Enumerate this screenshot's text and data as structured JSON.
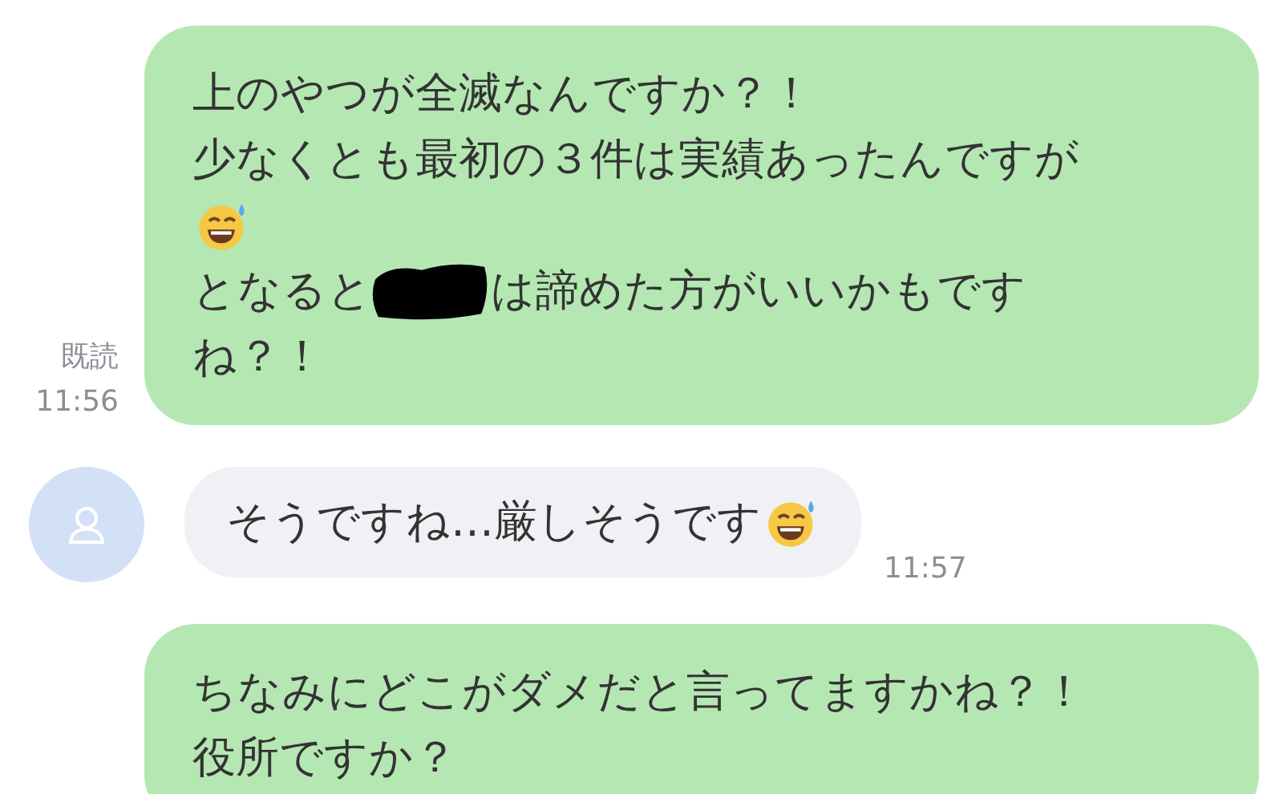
{
  "messages": [
    {
      "kind": "sent",
      "read_receipt": "既読",
      "time": "11:56",
      "lines": [
        [
          {
            "kind": "text",
            "text": "上のやつが全滅なんですか？！"
          }
        ],
        [
          {
            "kind": "text",
            "text": "少なくとも最初の３件は実績あったんですが"
          }
        ],
        [
          {
            "kind": "emoji"
          }
        ],
        [
          {
            "kind": "text",
            "text": "となると"
          },
          {
            "kind": "redaction"
          },
          {
            "kind": "text",
            "text": "は諦めた方がいいかもです"
          }
        ],
        [
          {
            "kind": "text",
            "text": "ね？！"
          }
        ]
      ]
    },
    {
      "kind": "received",
      "time": "11:57",
      "lines": [
        [
          {
            "kind": "text",
            "text": "そうですね…厳しそうです"
          },
          {
            "kind": "emoji"
          }
        ]
      ]
    },
    {
      "kind": "sent",
      "lines": [
        [
          {
            "kind": "text",
            "text": "ちなみにどこがダメだと言ってますかね？！"
          }
        ],
        [
          {
            "kind": "text",
            "text": "役所ですか？"
          }
        ]
      ]
    }
  ]
}
